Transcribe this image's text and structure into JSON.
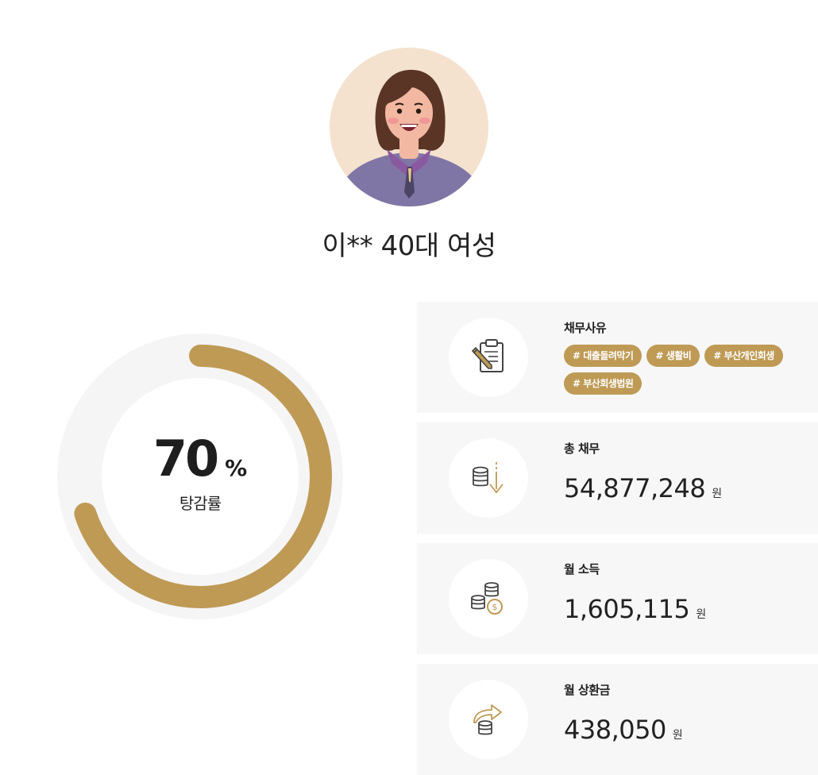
{
  "profile": {
    "avatar_icon": "woman-avatar-icon",
    "name": "이** 40대 여성"
  },
  "gauge": {
    "value": "70",
    "unit": "%",
    "label": "탕감률",
    "percent": 70,
    "accent_color": "#be9a55",
    "track_color": "#f5f5f5"
  },
  "cards": {
    "reason": {
      "icon": "clipboard-pen-icon",
      "title": "채무사유",
      "tags": [
        "# 대출돌려막기",
        "# 생활비",
        "# 부산개인회생",
        "# 부산회생법원"
      ]
    },
    "total_debt": {
      "icon": "coins-down-arrow-icon",
      "title": "총 채무",
      "value": "54,877,248",
      "unit": "원"
    },
    "monthly_income": {
      "icon": "coins-stack-icon",
      "title": "월 소득",
      "value": "1,605,115",
      "unit": "원"
    },
    "monthly_repayment": {
      "icon": "coins-repay-arrow-icon",
      "title": "월 상환금",
      "value": "438,050",
      "unit": "원"
    }
  }
}
